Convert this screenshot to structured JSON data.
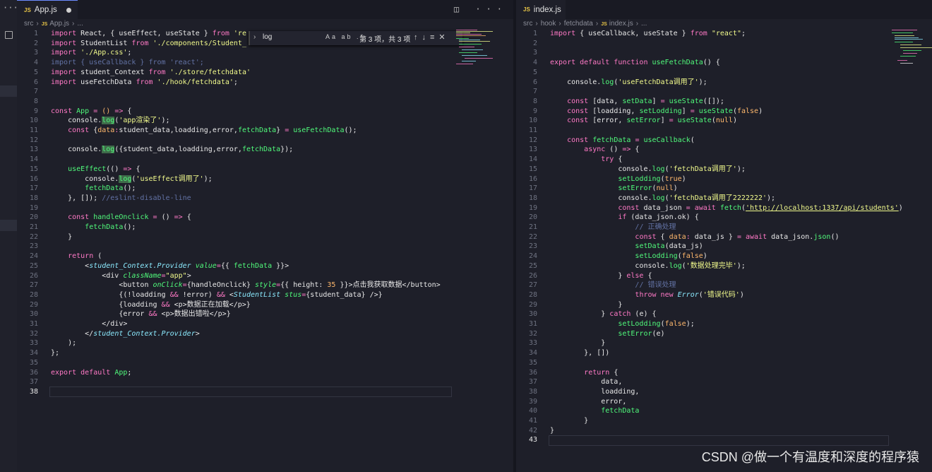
{
  "left_editor": {
    "tab_label": "App.js",
    "tab_badge": "JS",
    "breadcrumb": [
      "src",
      "App.js",
      "..."
    ],
    "lines": [
      "1",
      "2",
      "3",
      "4",
      "5",
      "6",
      "7",
      "8",
      "9",
      "10",
      "11",
      "12",
      "13",
      "14",
      "15",
      "16",
      "17",
      "18",
      "19",
      "20",
      "21",
      "22",
      "23",
      "24",
      "25",
      "26",
      "27",
      "28",
      "29",
      "30",
      "31",
      "32",
      "33",
      "34",
      "35",
      "36",
      "37",
      "38"
    ]
  },
  "find_widget": {
    "query": "log",
    "options": "Aa ab .*",
    "result": "第 3 项，共 3 项"
  },
  "right_editor": {
    "tab_label": "index.js",
    "tab_badge": "JS",
    "breadcrumb": [
      "src",
      "hook",
      "fetchdata",
      "index.js",
      "..."
    ],
    "lines": [
      "1",
      "2",
      "3",
      "4",
      "5",
      "6",
      "7",
      "8",
      "9",
      "10",
      "11",
      "12",
      "13",
      "14",
      "15",
      "16",
      "17",
      "18",
      "19",
      "20",
      "21",
      "22",
      "23",
      "24",
      "25",
      "26",
      "27",
      "28",
      "29",
      "30",
      "31",
      "32",
      "33",
      "34",
      "35",
      "36",
      "37",
      "38",
      "39",
      "40",
      "41",
      "42",
      "43"
    ]
  },
  "watermark": "CSDN @做一个有温度和深度的程序猿"
}
